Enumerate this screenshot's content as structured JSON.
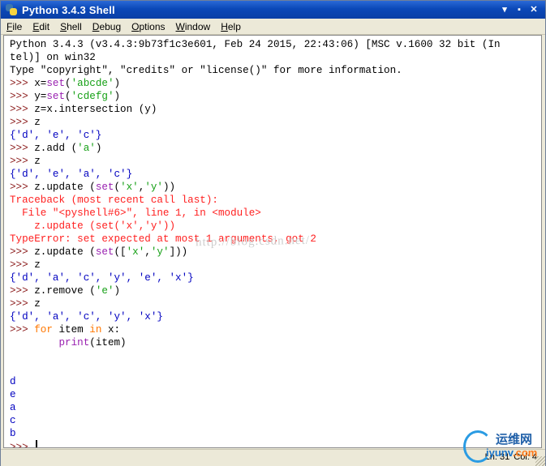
{
  "window": {
    "title": "Python 3.4.3 Shell",
    "controls": [
      "▾",
      "▪",
      "✕"
    ]
  },
  "menu": [
    {
      "ul": "F",
      "rest": "ile"
    },
    {
      "ul": "E",
      "rest": "dit"
    },
    {
      "ul": "S",
      "rest": "hell"
    },
    {
      "ul": "D",
      "rest": "ebug"
    },
    {
      "ul": "O",
      "rest": "ptions"
    },
    {
      "ul": "W",
      "rest": "indow"
    },
    {
      "ul": "H",
      "rest": "elp"
    }
  ],
  "shell_lines": [
    [
      {
        "t": "Python 3.4.3 (v3.4.3:9b73f1c3e601, Feb 24 2015, 22:43:06) [MSC v.1600 32 bit (In",
        "c": "out"
      }
    ],
    [
      {
        "t": "tel)] on win32",
        "c": "out"
      }
    ],
    [
      {
        "t": "Type \"copyright\", \"credits\" or \"license()\" for more information.",
        "c": "out"
      }
    ],
    [
      {
        "t": ">>> ",
        "c": "prompt"
      },
      {
        "t": "x=",
        "c": "code"
      },
      {
        "t": "set",
        "c": "builtin"
      },
      {
        "t": "(",
        "c": "code"
      },
      {
        "t": "'abcde'",
        "c": "str"
      },
      {
        "t": ")",
        "c": "code"
      }
    ],
    [
      {
        "t": ">>> ",
        "c": "prompt"
      },
      {
        "t": "y=",
        "c": "code"
      },
      {
        "t": "set",
        "c": "builtin"
      },
      {
        "t": "(",
        "c": "code"
      },
      {
        "t": "'cdefg'",
        "c": "str"
      },
      {
        "t": ")",
        "c": "code"
      }
    ],
    [
      {
        "t": ">>> ",
        "c": "prompt"
      },
      {
        "t": "z=x.intersection (y)",
        "c": "code"
      }
    ],
    [
      {
        "t": ">>> ",
        "c": "prompt"
      },
      {
        "t": "z",
        "c": "code"
      }
    ],
    [
      {
        "t": "{'d', 'e', 'c'}",
        "c": "result"
      }
    ],
    [
      {
        "t": ">>> ",
        "c": "prompt"
      },
      {
        "t": "z.add (",
        "c": "code"
      },
      {
        "t": "'a'",
        "c": "str"
      },
      {
        "t": ")",
        "c": "code"
      }
    ],
    [
      {
        "t": ">>> ",
        "c": "prompt"
      },
      {
        "t": "z",
        "c": "code"
      }
    ],
    [
      {
        "t": "{'d', 'e', 'a', 'c'}",
        "c": "result"
      }
    ],
    [
      {
        "t": ">>> ",
        "c": "prompt"
      },
      {
        "t": "z.update (",
        "c": "code"
      },
      {
        "t": "set",
        "c": "builtin"
      },
      {
        "t": "(",
        "c": "code"
      },
      {
        "t": "'x'",
        "c": "str"
      },
      {
        "t": ",",
        "c": "code"
      },
      {
        "t": "'y'",
        "c": "str"
      },
      {
        "t": "))",
        "c": "code"
      }
    ],
    [
      {
        "t": "Traceback (most recent call last):",
        "c": "err"
      }
    ],
    [
      {
        "t": "  File \"<pyshell#6>\", line 1, in <module>",
        "c": "err"
      }
    ],
    [
      {
        "t": "    z.update (set('x','y'))",
        "c": "err"
      }
    ],
    [
      {
        "t": "TypeError: set expected at most 1 arguments, got 2",
        "c": "err"
      }
    ],
    [
      {
        "t": ">>> ",
        "c": "prompt"
      },
      {
        "t": "z.update (",
        "c": "code"
      },
      {
        "t": "set",
        "c": "builtin"
      },
      {
        "t": "([",
        "c": "code"
      },
      {
        "t": "'x'",
        "c": "str"
      },
      {
        "t": ",",
        "c": "code"
      },
      {
        "t": "'y'",
        "c": "str"
      },
      {
        "t": "]))",
        "c": "code"
      }
    ],
    [
      {
        "t": ">>> ",
        "c": "prompt"
      },
      {
        "t": "z",
        "c": "code"
      }
    ],
    [
      {
        "t": "{'d', 'a', 'c', 'y', 'e', 'x'}",
        "c": "result"
      }
    ],
    [
      {
        "t": ">>> ",
        "c": "prompt"
      },
      {
        "t": "z.remove (",
        "c": "code"
      },
      {
        "t": "'e'",
        "c": "str"
      },
      {
        "t": ")",
        "c": "code"
      }
    ],
    [
      {
        "t": ">>> ",
        "c": "prompt"
      },
      {
        "t": "z",
        "c": "code"
      }
    ],
    [
      {
        "t": "{'d', 'a', 'c', 'y', 'x'}",
        "c": "result"
      }
    ],
    [
      {
        "t": ">>> ",
        "c": "prompt"
      },
      {
        "t": "for",
        "c": "kw"
      },
      {
        "t": " item ",
        "c": "code"
      },
      {
        "t": "in",
        "c": "kw"
      },
      {
        "t": " x:",
        "c": "code"
      }
    ],
    [
      {
        "t": "        ",
        "c": "code"
      },
      {
        "t": "print",
        "c": "builtin"
      },
      {
        "t": "(item)",
        "c": "code"
      }
    ],
    [],
    [],
    [
      {
        "t": "d",
        "c": "result"
      }
    ],
    [
      {
        "t": "e",
        "c": "result"
      }
    ],
    [
      {
        "t": "a",
        "c": "result"
      }
    ],
    [
      {
        "t": "c",
        "c": "result"
      }
    ],
    [
      {
        "t": "b",
        "c": "result"
      }
    ],
    [
      {
        "t": ">>> ",
        "c": "prompt"
      },
      {
        "t": "",
        "c": "caret"
      }
    ]
  ],
  "watermark": "http://blog.csdn.net/",
  "status": {
    "line": "Ln: 31",
    "col": "Col: 4"
  },
  "logo": {
    "top": "运维网",
    "bottom": "iyunv",
    "suffix": ".com"
  }
}
